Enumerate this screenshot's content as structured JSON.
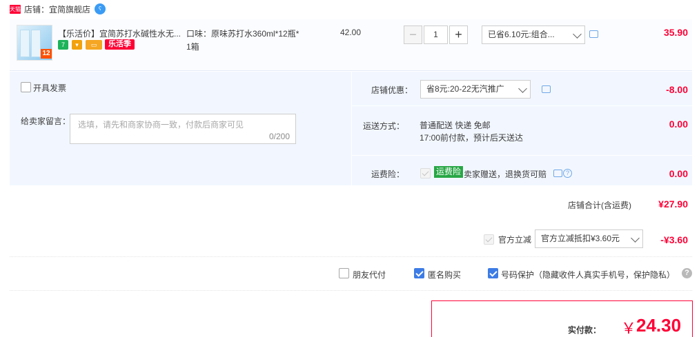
{
  "shop": {
    "badge": "天猫",
    "label": "店铺：宜简旗舰店"
  },
  "item": {
    "thumb_badge": "12",
    "title": "【乐活价】宜简苏打水碱性水无...",
    "tag_huo": "乐活季",
    "sku_line1": "口味：原味苏打水360ml*12瓶*",
    "sku_line2": "1箱",
    "unit_price": "42.00",
    "quantity": "1",
    "qty_minus": "−",
    "qty_plus": "+",
    "promo_select": "已省6.10元:组合...",
    "subtotal": "35.90"
  },
  "invoice": {
    "label": "开具发票"
  },
  "message": {
    "label": "给卖家留言：",
    "placeholder": "选填，请先和商家协商一致，付款后商家可见",
    "counter": "0/200"
  },
  "shop_discount": {
    "label": "店铺优惠：",
    "selected": "省8元:20-22无汽推广",
    "amount": "-8.00"
  },
  "shipping": {
    "label": "运送方式：",
    "line1": "普通配送 快递 免邮",
    "line2": "17:00前付款，预计后天送达",
    "amount": "0.00"
  },
  "insurance": {
    "label": "运费险：",
    "badge": "运费险",
    "desc": "卖家赠送，退换货可赔",
    "amount": "0.00"
  },
  "shop_total": {
    "label": "店铺合计(含运费)",
    "amount": "¥27.90"
  },
  "official_discount": {
    "label": "官方立减",
    "selected": "官方立减抵扣¥3.60元",
    "amount": "-¥3.60"
  },
  "options": {
    "friend_pay": "朋友代付",
    "anonymous": "匿名购买",
    "number_protect": "号码保护（隐藏收件人真实手机号，保护隐私）"
  },
  "payment": {
    "label": "实付款：",
    "currency": "￥",
    "amount": "24.30"
  },
  "colors": {
    "price_red": "#ff0036",
    "panel_blue": "#f2f7ff",
    "check_blue": "#3d7ce6"
  }
}
